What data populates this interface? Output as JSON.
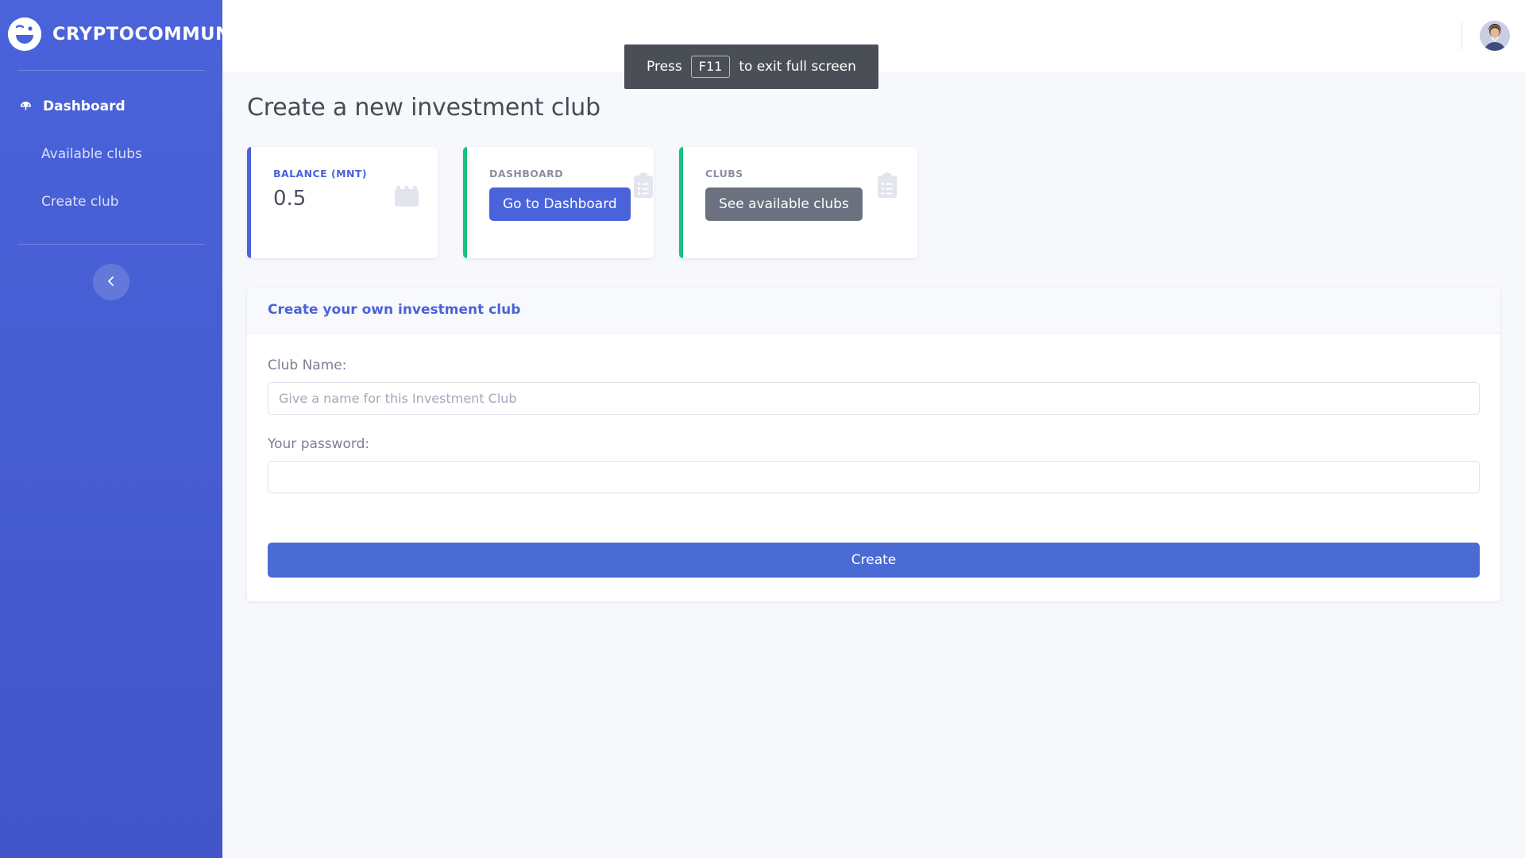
{
  "sidebar": {
    "brand": {
      "title": "CRYPTOCOMMUNE",
      "logo_icon": "wink-face-logo-icon"
    },
    "items": [
      {
        "label": "Dashboard",
        "icon": "speedometer-icon",
        "active": true
      },
      {
        "label": "Available clubs",
        "icon": "",
        "active": false
      },
      {
        "label": "Create club",
        "icon": "",
        "active": false
      }
    ],
    "collapse_icon": "chevron-left-icon"
  },
  "topbar": {
    "avatar_icon": "user-avatar"
  },
  "page": {
    "title": "Create a new investment club"
  },
  "cards": [
    {
      "label": "BALANCE (MNT)",
      "label_color": "#4a63da",
      "value": "0.5",
      "accent": "#4a63da",
      "icon": "calendar-icon",
      "button": null
    },
    {
      "label": "DASHBOARD",
      "label_color": "#8a90a2",
      "value": null,
      "accent": "#17c27f",
      "icon": "clipboard-list-icon",
      "button": {
        "label": "Go to Dashboard",
        "color": "#4a63da"
      }
    },
    {
      "label": "CLUBS",
      "label_color": "#8a90a2",
      "value": null,
      "accent": "#17c27f",
      "icon": "clipboard-list-icon",
      "button": {
        "label": "See available clubs",
        "color": "#6c7180"
      }
    }
  ],
  "form": {
    "header": "Create your own investment club",
    "club_name": {
      "label": "Club Name:",
      "placeholder": "Give a name for this Investment Club",
      "value": ""
    },
    "password": {
      "label": "Your password:",
      "placeholder": "",
      "value": ""
    },
    "submit_label": "Create"
  },
  "fullscreen_toast": {
    "prefix": "Press",
    "key": "F11",
    "suffix": "to exit full screen"
  },
  "colors": {
    "brand_blue": "#4a63da",
    "accent_green": "#17c27f",
    "grey_button": "#6c7180",
    "toast_bg": "#4a4f57"
  }
}
